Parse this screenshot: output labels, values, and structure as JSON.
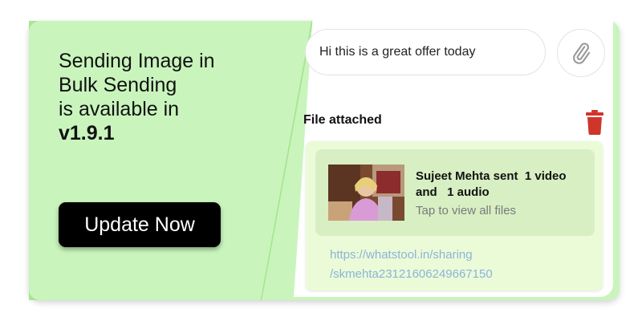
{
  "promo": {
    "headline_lines": [
      "Sending Image in",
      "Bulk Sending",
      "is available in"
    ],
    "version": "v1.9.1",
    "button_label": "Update Now"
  },
  "composer": {
    "message_text": "Hi this is a great offer today",
    "attach_icon": "paperclip-icon"
  },
  "attachment": {
    "section_label": "File attached",
    "delete_icon": "trash-icon",
    "media_title": "Sujeet Mehta sent  1 video\nand   1 audio",
    "media_subtitle": "Tap to view all files",
    "link_lines": [
      "https://whatstool.in/sharing",
      "/skmehta23121606249667150"
    ]
  },
  "colors": {
    "promo_bg": "#c9f5bd",
    "button_bg": "#000000",
    "card_bg": "#ebfbd8",
    "media_bg": "#d7efc3",
    "link": "#8bb4d8",
    "trash": "#d0352b"
  }
}
